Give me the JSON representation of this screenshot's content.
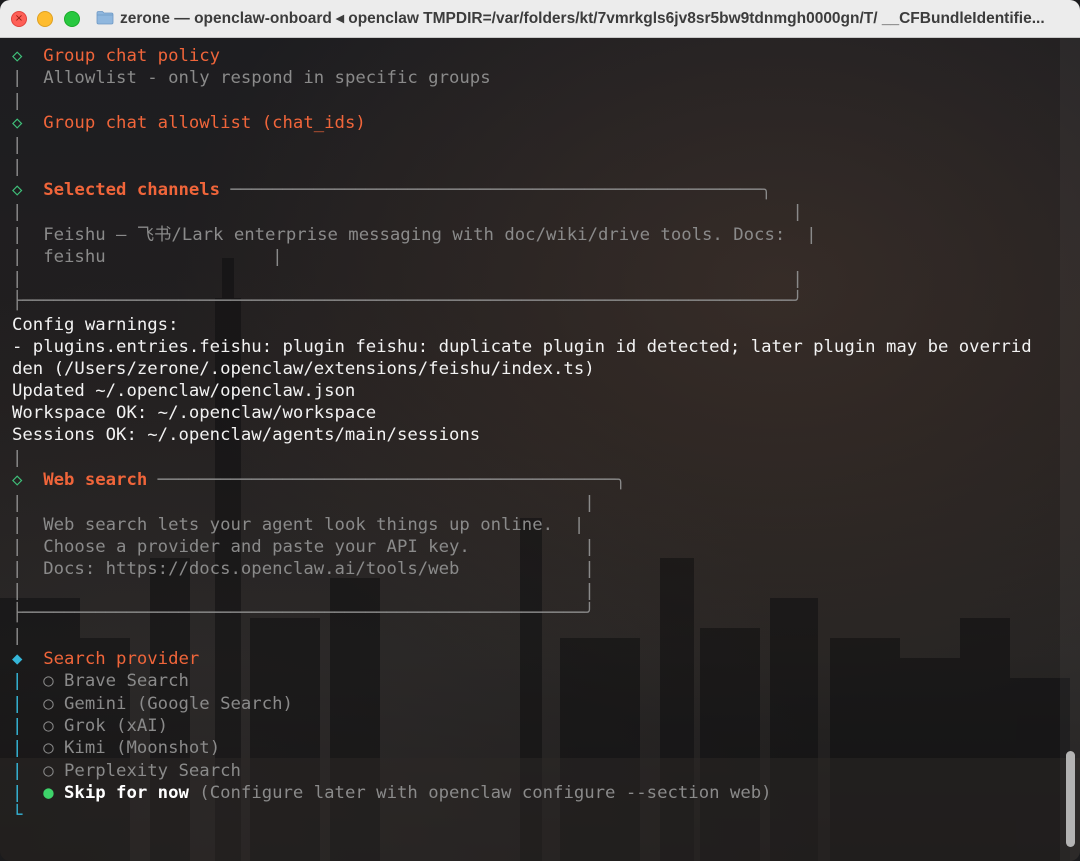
{
  "window": {
    "title": "zerone — openclaw-onboard ◂ openclaw TMPDIR=/var/folders/kt/7vmrkgls6jv8sr5bw9tdnmgh0000gn/T/ __CFBundleIdentifie...",
    "folder_icon": "folder-icon",
    "close_glyph": "×"
  },
  "colors": {
    "accent": "#f0653a",
    "step_done": "#3fc07a",
    "step_active": "#35b6d8",
    "selected_radio": "#3ed36a",
    "text_muted": "#8a8a8a",
    "text": "#e6e6e6"
  },
  "terminal": {
    "group_chat_policy": {
      "marker": "◇",
      "title": "Group chat policy",
      "value": "Allowlist - only respond in specific groups"
    },
    "group_chat_allowlist": {
      "marker": "◇",
      "title": "Group chat allowlist (chat_ids)"
    },
    "selected_channels": {
      "marker": "◇",
      "title": "Selected channels",
      "body_line_1": "Feishu — 飞书/Lark enterprise messaging with doc/wiki/drive tools. Docs:",
      "body_line_2": "feishu"
    },
    "config_warnings": {
      "heading": "Config warnings:",
      "warning_line_1": "- plugins.entries.feishu: plugin feishu: duplicate plugin id detected; later plugin may be overrid",
      "warning_line_2": "den (/Users/zerone/.openclaw/extensions/feishu/index.ts)"
    },
    "status": {
      "updated": "Updated ~/.openclaw/openclaw.json",
      "workspace": "Workspace OK: ~/.openclaw/workspace",
      "sessions": "Sessions OK: ~/.openclaw/agents/main/sessions"
    },
    "web_search": {
      "marker": "◇",
      "title": "Web search",
      "body_line_1": "Web search lets your agent look things up online.",
      "body_line_2": "Choose a provider and paste your API key.",
      "body_line_3": "Docs: https://docs.openclaw.ai/tools/web"
    },
    "search_provider": {
      "marker": "◆",
      "title": "Search provider",
      "unselected_radio": "○",
      "selected_radio": "●",
      "options": [
        {
          "label": "Brave Search",
          "selected": false
        },
        {
          "label": "Gemini (Google Search)",
          "selected": false
        },
        {
          "label": "Grok (xAI)",
          "selected": false
        },
        {
          "label": "Kimi (Moonshot)",
          "selected": false
        },
        {
          "label": "Perplexity Search",
          "selected": false
        },
        {
          "label": "Skip for now",
          "hint": "(Configure later with openclaw configure --section web)",
          "selected": true
        }
      ]
    }
  }
}
